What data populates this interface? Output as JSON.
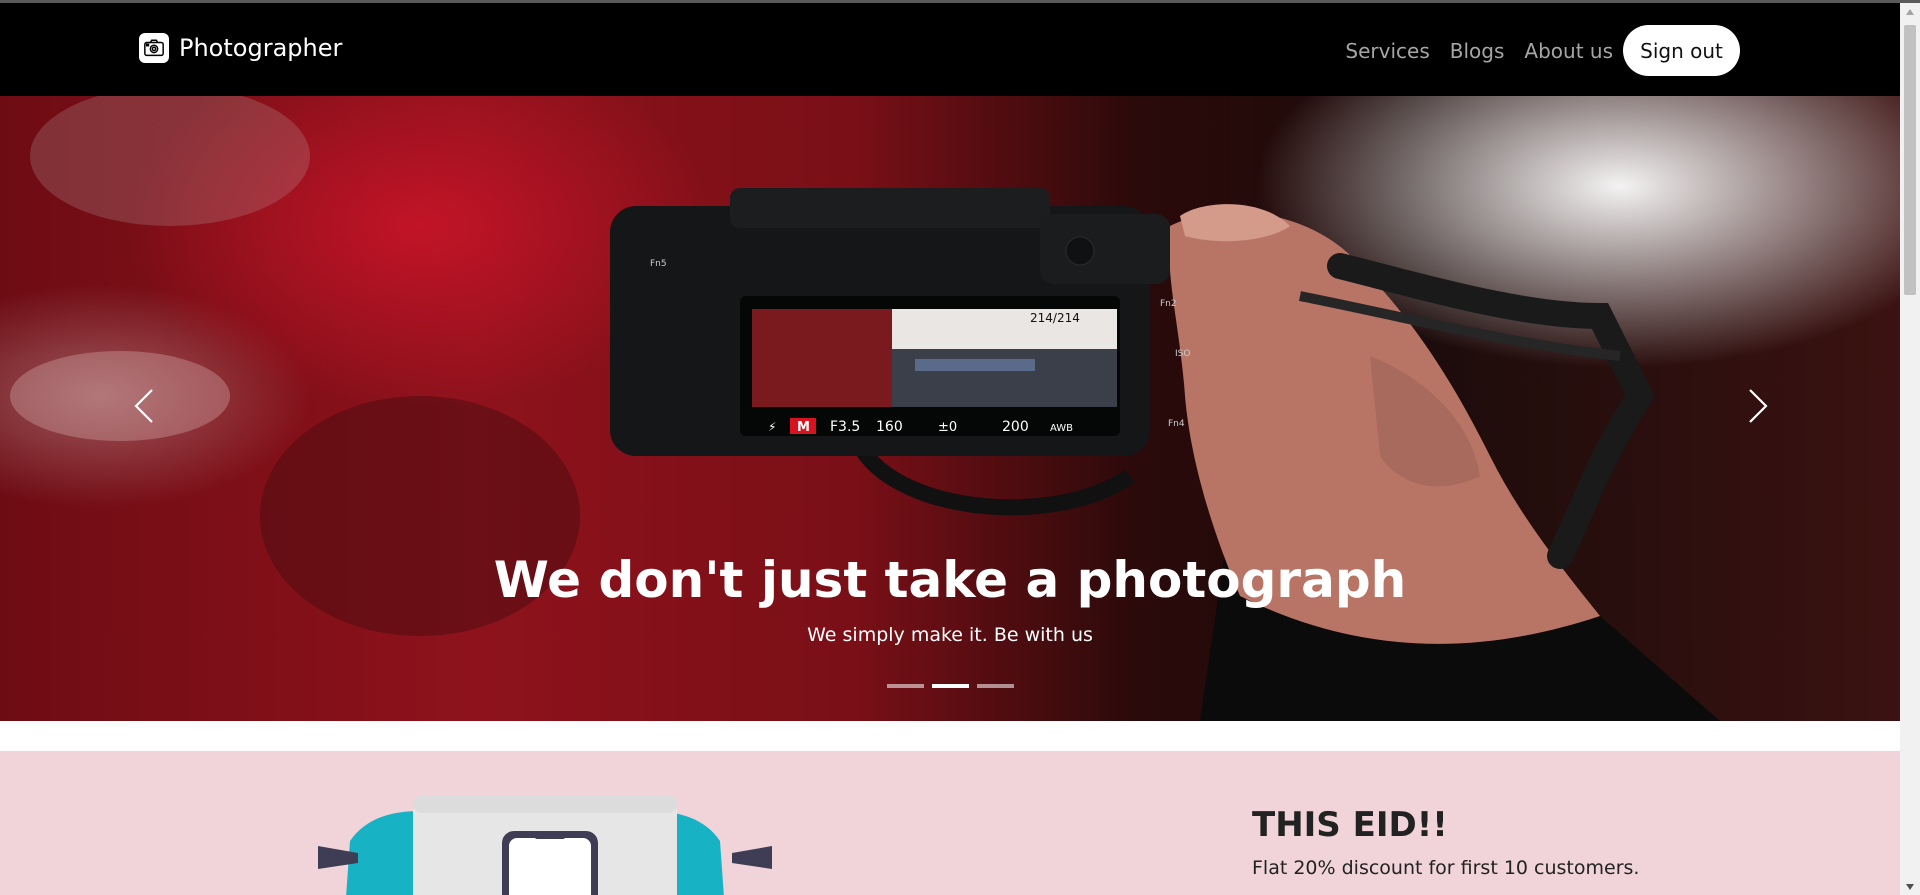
{
  "navbar": {
    "brand": "Photographer",
    "links": [
      "Services",
      "Blogs",
      "About us"
    ],
    "signout_label": "Sign out"
  },
  "hero": {
    "title": "We don't just take a photograph",
    "subtitle": "We simply make it. Be with us",
    "slide_count": 3,
    "active_slide": 2,
    "camera_readout": {
      "mode": "M",
      "aperture": "F3.5",
      "shutter": "160",
      "exposure": "±0",
      "iso": "200",
      "wb": "AWB",
      "frame": "214/214"
    }
  },
  "promo": {
    "title": "THIS EID!!",
    "text": "Flat 20% discount for first 10 customers."
  },
  "icons": {
    "brand_logo": "camera-icon",
    "prev": "chevron-left-icon",
    "next": "chevron-right-icon"
  },
  "colors": {
    "navbar_bg": "#000000",
    "promo_bg": "#f0d4d9",
    "accent_teal": "#17b3c4"
  }
}
